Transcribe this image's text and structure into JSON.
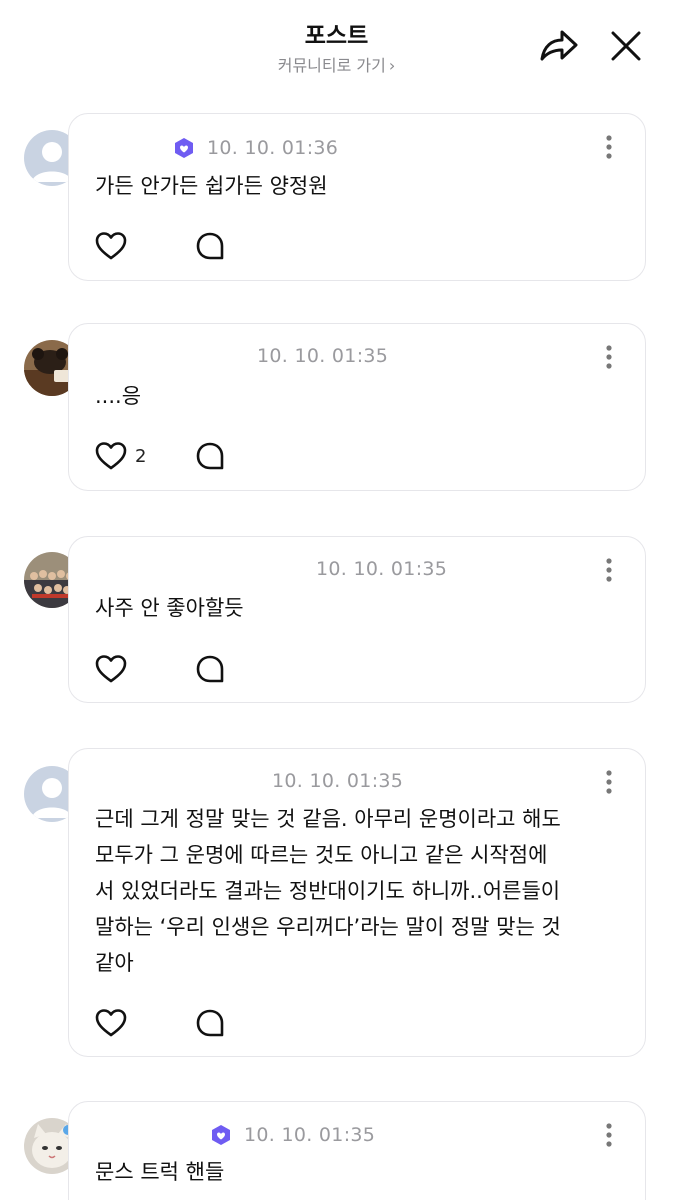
{
  "header": {
    "title": "포스트",
    "community_link": "커뮤니티로 가기",
    "share_icon": "share-arrow-icon",
    "close_icon": "close-icon"
  },
  "posts": [
    {
      "time": "10. 10. 01:36",
      "verified": true,
      "text": "가든 안가든 쉽가든 양정원",
      "likes": ""
    },
    {
      "time": "10. 10. 01:35",
      "verified": false,
      "text": "....응",
      "likes": "2"
    },
    {
      "time": "10. 10. 01:35",
      "verified": false,
      "text": "사주 안 좋아할듯",
      "likes": ""
    },
    {
      "time": "10. 10. 01:35",
      "verified": false,
      "text": "근데 그게 정말 맞는 것 같음. 아무리 운명이라고 해도\n모두가 그 운명에 따르는 것도 아니고 같은 시작점에\n서 있었더라도 결과는 정반대이기도 하니까..어른들이\n말하는 ‘우리 인생은 우리꺼다’라는 말이 정말 맞는 것\n같아",
      "likes": ""
    },
    {
      "time": "10. 10. 01:35",
      "verified": true,
      "text": "문스 트럭 핸들",
      "likes": ""
    }
  ],
  "colors": {
    "badge": "#6f5cf2",
    "timestamp": "#9a9a9e",
    "card_border": "#e6e6ea"
  }
}
